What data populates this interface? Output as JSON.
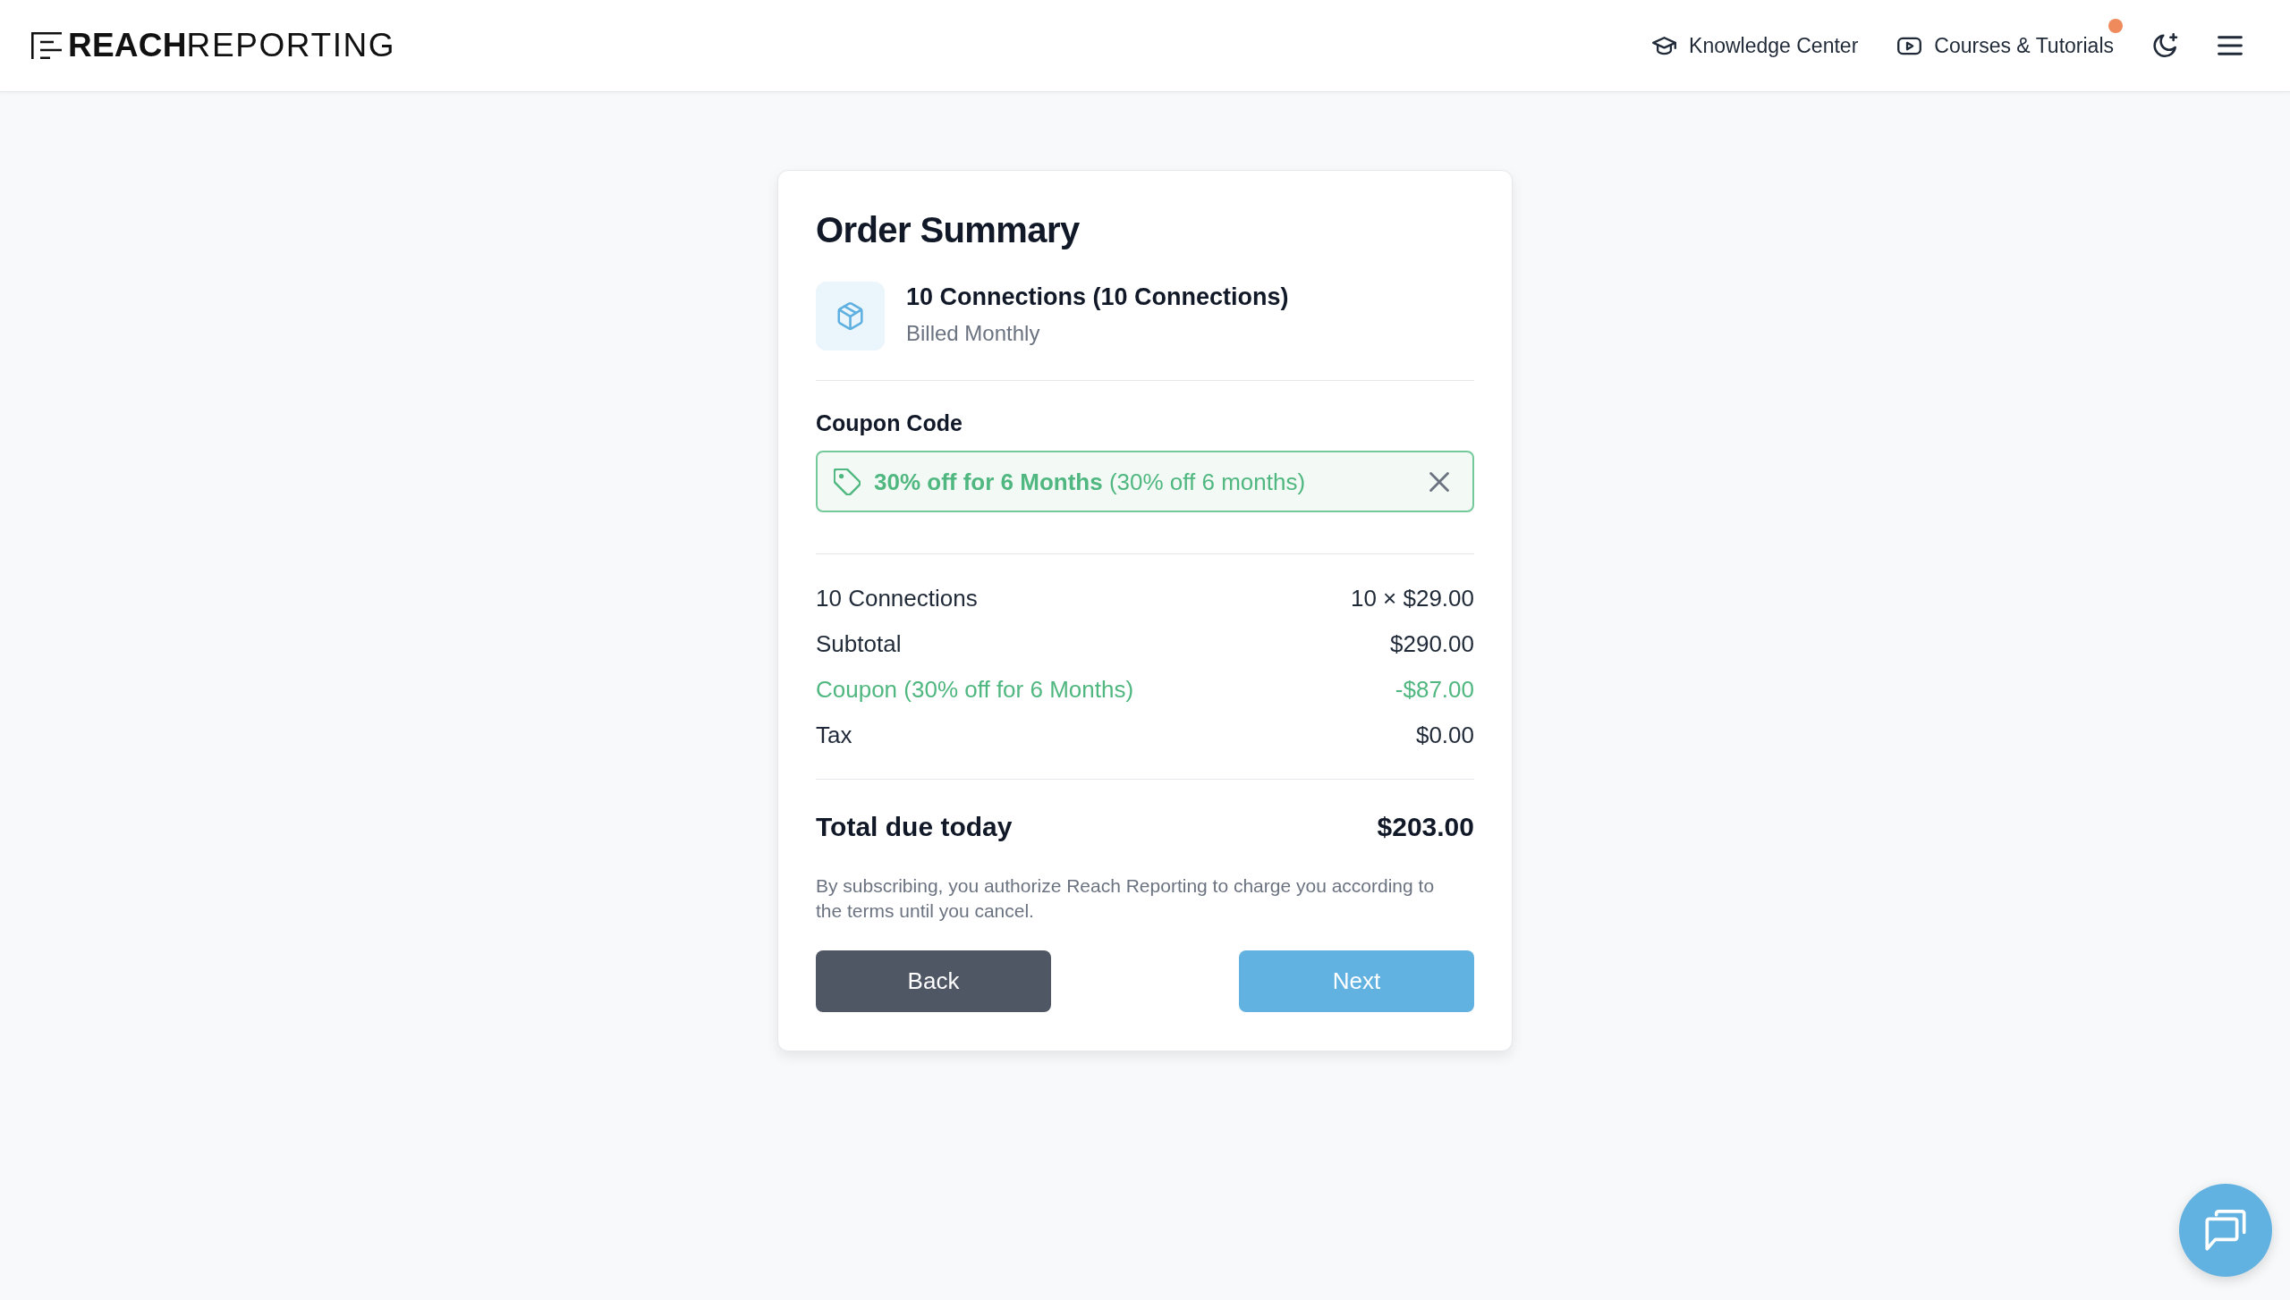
{
  "header": {
    "logo": "**REACH**REPORTING",
    "nav": [
      {
        "label": "Knowledge Center",
        "notification": false
      },
      {
        "label": "Courses & Tutorials",
        "notification": true
      }
    ]
  },
  "order_summary": {
    "title": "Order Summary",
    "product": {
      "name": "10 Connections (10 Connections)",
      "billing": "Billed Monthly"
    },
    "coupon": {
      "label": "Coupon Code",
      "applied": "**30% off for 6 Months** (30% off 6 months)"
    },
    "lines": [
      {
        "kind": "charge",
        "label": "10 Connections",
        "value": "10 × $29.00"
      },
      {
        "kind": "charge",
        "label": "Subtotal",
        "value": "$290.00"
      },
      {
        "kind": "discount",
        "label": "Coupon (30% off for 6 Months)",
        "value": "-$87.00"
      },
      {
        "kind": "charge",
        "label": "Tax",
        "value": "$0.00"
      }
    ],
    "total": {
      "label": "Total due today",
      "value": "$203.00"
    },
    "disclaimer": "By subscribing, you authorize Reach Reporting to charge you according to the terms until you cancel.",
    "buttons": [
      {
        "kind": "secondary",
        "label": "Back"
      },
      {
        "kind": "primary",
        "label": "Next"
      }
    ]
  }
}
